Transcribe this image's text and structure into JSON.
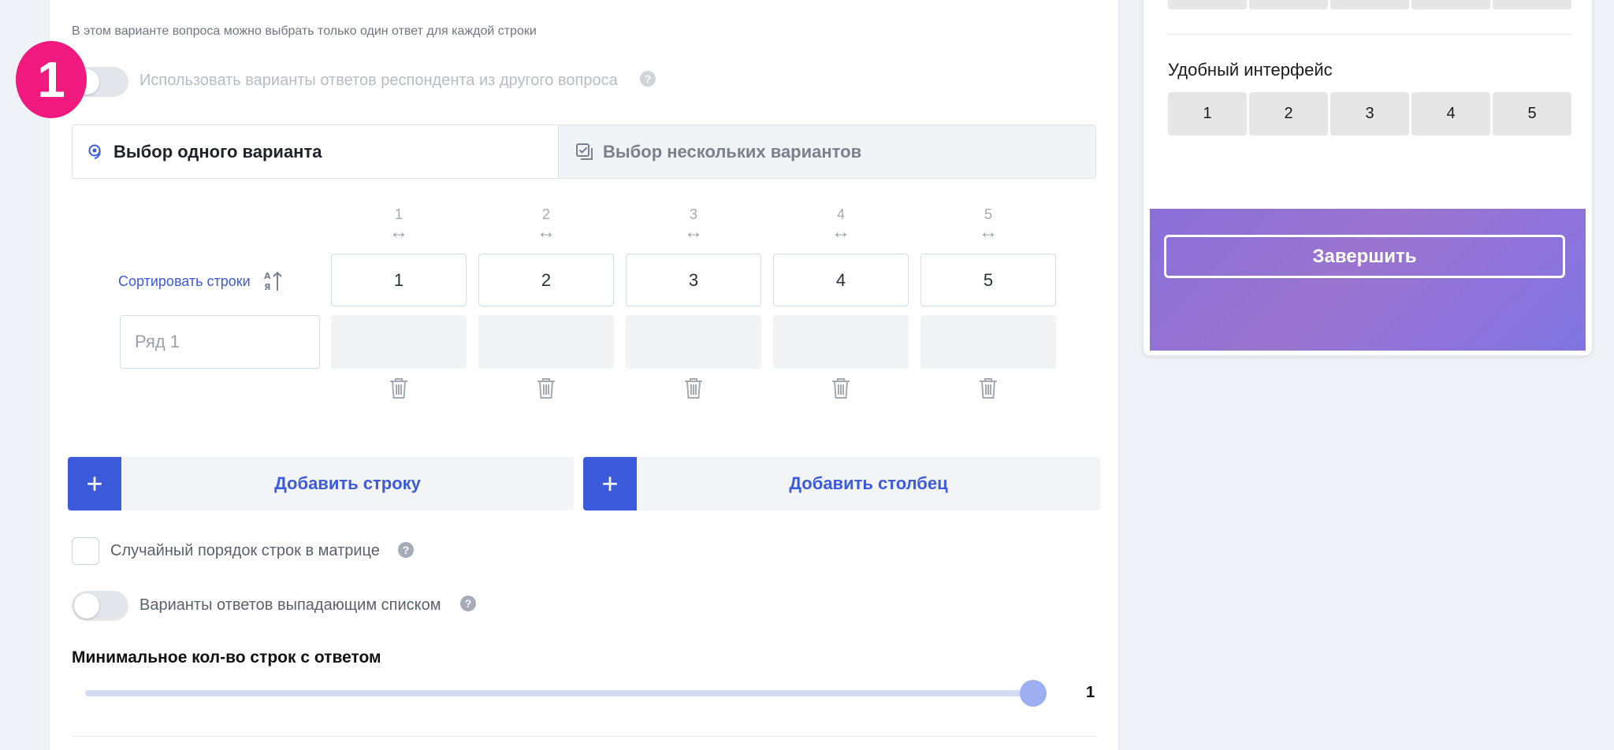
{
  "hint": "В этом варианте вопроса можно выбрать только один ответ для каждой строки",
  "step_badge": "1",
  "use_other_answers": {
    "label": "Использовать варианты ответов респондента из другого вопроса",
    "help": "?"
  },
  "tabs": [
    {
      "label": "Выбор одного варианта",
      "icon": "radio-target-icon",
      "active": true
    },
    {
      "label": "Выбор нескольких вариантов",
      "icon": "checkbox-stack-icon",
      "active": false
    }
  ],
  "matrix": {
    "sort_label": "Сортировать строки",
    "columns": [
      {
        "number": "1",
        "value": "1",
        "arrow": "↔"
      },
      {
        "number": "2",
        "value": "2",
        "arrow": "↔"
      },
      {
        "number": "3",
        "value": "3",
        "arrow": "↔"
      },
      {
        "number": "4",
        "value": "4",
        "arrow": "↔"
      },
      {
        "number": "5",
        "value": "5",
        "arrow": "↔"
      }
    ],
    "rows": [
      {
        "placeholder": "Ряд 1"
      }
    ]
  },
  "buttons": {
    "add_row": "Добавить строку",
    "add_column": "Добавить столбец",
    "plus": "+"
  },
  "random_order": {
    "label": "Случайный порядок строк в матрице",
    "help": "?"
  },
  "dropdown_answers": {
    "label": "Варианты ответов выпадающим списком",
    "help": "?"
  },
  "min_rows": {
    "title": "Минимальное кол-во строк с ответом",
    "value": "1",
    "fraction": 1.0
  },
  "preview": {
    "item_title": "Удобный интерфейс",
    "scale": [
      "1",
      "2",
      "3",
      "4",
      "5"
    ],
    "finish": "Завершить"
  }
}
